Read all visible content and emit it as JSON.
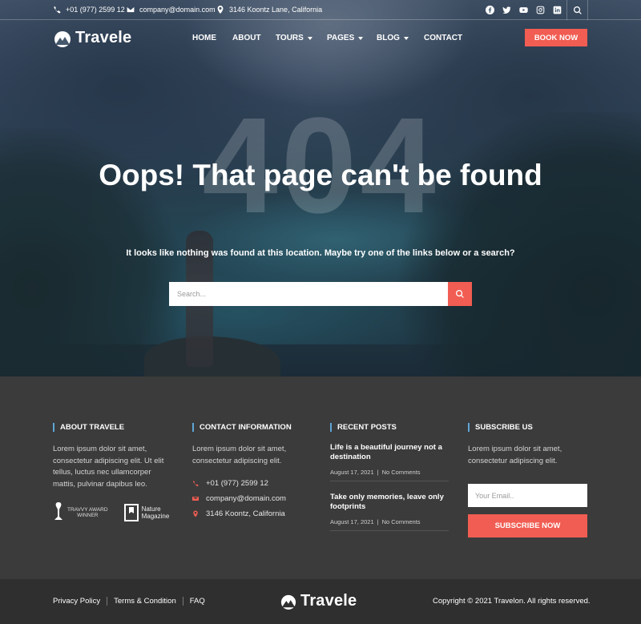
{
  "topbar": {
    "phone": "+01 (977) 2599 12",
    "email": "company@domain.com",
    "address": "3146 Koontz Lane, California",
    "social_icons": [
      "facebook-icon",
      "twitter-icon",
      "youtube-icon",
      "instagram-icon",
      "linkedin-icon"
    ]
  },
  "brand": {
    "name": "Travele"
  },
  "nav": {
    "items": [
      {
        "label": "HOME",
        "dropdown": false
      },
      {
        "label": "ABOUT",
        "dropdown": false
      },
      {
        "label": "TOURS",
        "dropdown": true
      },
      {
        "label": "PAGES",
        "dropdown": true
      },
      {
        "label": "BLOG",
        "dropdown": true
      },
      {
        "label": "CONTACT",
        "dropdown": false
      }
    ],
    "book_label": "BOOK NOW"
  },
  "hero": {
    "bg_number": "404",
    "title": "Oops! That page can't be found",
    "subtitle": "It looks like nothing was found at this location. Maybe try one of the links below or a search?",
    "search_placeholder": "Search..."
  },
  "footer": {
    "about": {
      "heading": "ABOUT TRAVELE",
      "text": "Lorem ipsum dolor sit amet, consectetur adipiscing elit. Ut elit tellus, luctus nec ullamcorper mattis, pulvinar dapibus leo.",
      "award_line1": "TRAVVY AWARD",
      "award_line2": "WINNER",
      "magazine_line1": "Nature",
      "magazine_line2": "Magazine"
    },
    "contact": {
      "heading": "CONTACT INFORMATION",
      "text": "Lorem ipsum dolor sit amet, consectetur adipiscing elit.",
      "phone": "+01 (977) 2599 12",
      "email": "company@domain.com",
      "address": "3146 Koontz, California"
    },
    "posts": {
      "heading": "RECENT POSTS",
      "items": [
        {
          "title": "Life is a beautiful journey not a destination",
          "date": "August 17, 2021",
          "comments": "No Comments"
        },
        {
          "title": "Take only memories, leave only footprints",
          "date": "August 17, 2021",
          "comments": "No Comments"
        }
      ]
    },
    "subscribe": {
      "heading": "SUBSCRIBE US",
      "text": "Lorem ipsum dolor sit amet, consectetur adipiscing elit.",
      "email_placeholder": "Your Email..",
      "button_label": "SUBSCRIBE NOW"
    }
  },
  "bottom": {
    "links": [
      "Privacy Policy",
      "Terms & Condition",
      "FAQ"
    ],
    "copyright": "Copyright © 2021 Travelon. All rights reserved."
  },
  "colors": {
    "accent": "#f15d52",
    "footer_bg": "#3b3b3b",
    "bottom_bg": "#2f2f2f",
    "heading_bar": "#5ea6d8"
  }
}
